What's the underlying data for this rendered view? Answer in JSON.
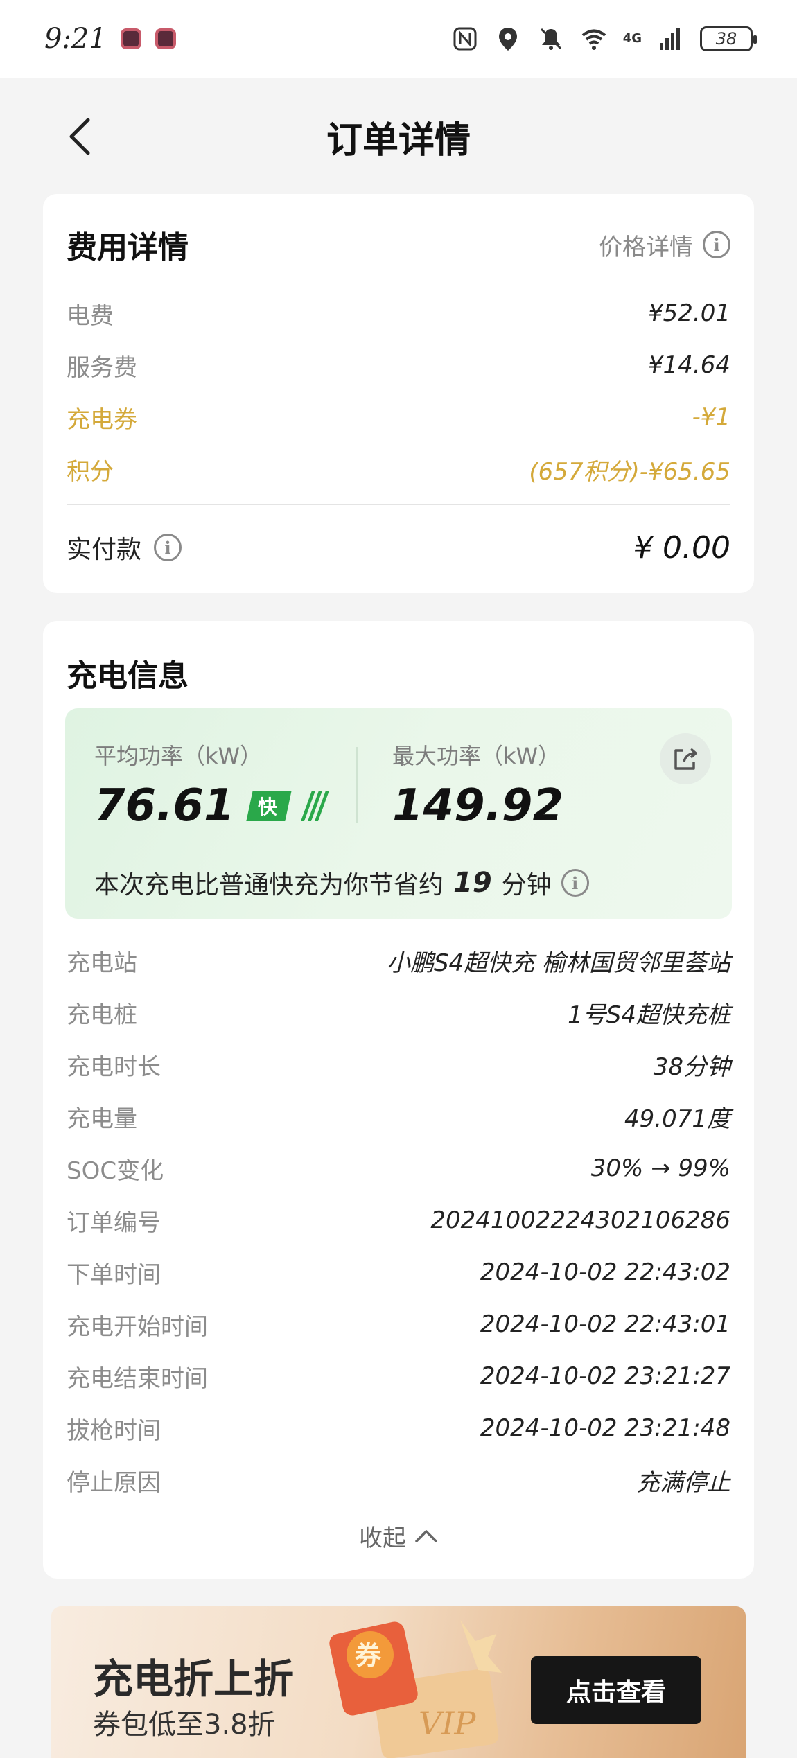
{
  "status_bar": {
    "time": "9:21",
    "network": "4G",
    "battery": "38"
  },
  "header": {
    "title": "订单详情"
  },
  "fee_card": {
    "title": "费用详情",
    "price_detail_label": "价格详情",
    "items": [
      {
        "label": "电费",
        "value": "¥52.01"
      },
      {
        "label": "服务费",
        "value": "¥14.64"
      },
      {
        "label": "充电券",
        "value": "-¥1"
      },
      {
        "label": "积分",
        "value": "(657积分)-¥65.65"
      }
    ],
    "paid_label": "实付款",
    "paid_value": "¥ 0.00"
  },
  "charge_card": {
    "title": "充电信息",
    "avg_power_label": "平均功率（kW）",
    "avg_power_value": "76.61",
    "fast_badge": "快",
    "max_power_label": "最大功率（kW）",
    "max_power_value": "149.92",
    "saving_prefix": "本次充电比普通快充为你节省约",
    "saving_minutes": "19",
    "saving_suffix": "分钟",
    "details": [
      {
        "label": "充电站",
        "value": "小鹏S4超快充 榆林国贸邻里荟站"
      },
      {
        "label": "充电桩",
        "value": "1号S4超快充桩"
      },
      {
        "label": "充电时长",
        "value": "38分钟"
      },
      {
        "label": "充电量",
        "value": "49.071度"
      },
      {
        "label": "SOC变化",
        "value": "30% → 99%"
      },
      {
        "label": "订单编号",
        "value": "20241002224302106286"
      },
      {
        "label": "下单时间",
        "value": "2024-10-02 22:43:02"
      },
      {
        "label": "充电开始时间",
        "value": "2024-10-02 22:43:01"
      },
      {
        "label": "充电结束时间",
        "value": "2024-10-02 23:21:27"
      },
      {
        "label": "拔枪时间",
        "value": "2024-10-02 23:21:48"
      },
      {
        "label": "停止原因",
        "value": "充满停止"
      }
    ],
    "collapse_label": "收起"
  },
  "banner": {
    "title": "充电折上折",
    "subtitle": "券包低至3.8折",
    "button_label": "点击查看",
    "coupon_text": "券",
    "vip_text": "VIP"
  },
  "colors": {
    "accent_gold": "#d4a93a",
    "fast_green": "#2aa84a"
  }
}
